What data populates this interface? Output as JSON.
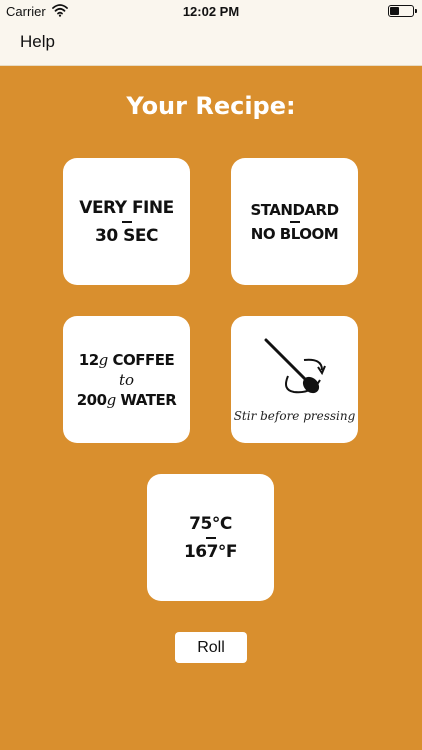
{
  "status_bar": {
    "carrier": "Carrier",
    "time": "12:02 PM"
  },
  "nav": {
    "help_label": "Help"
  },
  "recipe_title": "Your Recipe:",
  "cards": {
    "grind": {
      "line1": "VERY FINE",
      "line2": "30 SEC"
    },
    "bloom": {
      "line1": "STANDARD",
      "line2": "NO BLOOM"
    },
    "ratio": {
      "coffee_amount": "12",
      "coffee_unit": "g",
      "coffee_label": " COFFEE",
      "connector": "to",
      "water_amount": "200",
      "water_unit": "g",
      "water_label": " WATER"
    },
    "stir": {
      "icon": "spoon-stir-icon",
      "caption": "Stir before pressing"
    },
    "temperature": {
      "celsius": "75°C",
      "fahrenheit": "167°F"
    }
  },
  "roll_label": "Roll",
  "colors": {
    "background": "#d98f2e",
    "card": "#ffffff",
    "title": "#ffffff"
  }
}
